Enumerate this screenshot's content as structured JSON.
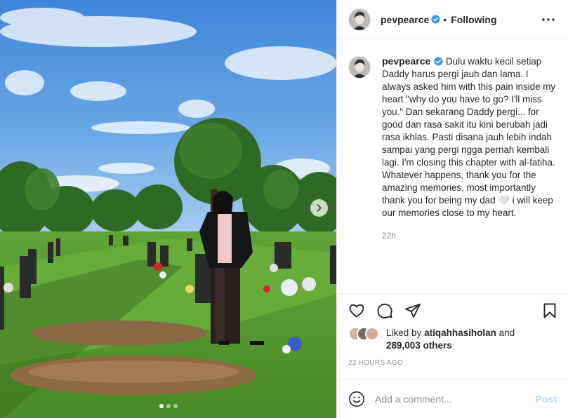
{
  "post": {
    "username": "pevpearce",
    "follow_state": "Following",
    "separator": "•",
    "caption": "Dulu waktu kecil setiap Daddy harus pergi jauh dan lama. I always asked him with this pain inside my heart \"why do you have to go? I'll miss you.\" Dan sekarang Daddy pergi... for good dan rasa sakit itu kini berubah jadi rasa ikhlas. Pasti disana jauh lebih indah sampai yang pergi ngga pernah kembali lagi. I'm closing this chapter with al-fatiha. Whatever happens, thank you for the amazing memories, most importantly thank you for being my dad 🤍 i will keep our memories close to my heart.",
    "caption_time": "22h",
    "liked_by_prefix": "Liked by",
    "liked_by_user": "atiqahhasiholan",
    "liked_by_and": "and",
    "liked_by_others": "289,003 others",
    "date": "22 HOURS AGO",
    "comment_placeholder": "Add a comment...",
    "post_button": "Post",
    "carousel": {
      "slide_count": 3,
      "active_slide": 1
    }
  },
  "icons": {
    "verified": "verified-badge-icon",
    "more": "more-options-icon",
    "like": "heart-icon",
    "comment": "comment-bubble-icon",
    "share": "paper-plane-icon",
    "save": "bookmark-icon",
    "emoji": "smiley-icon",
    "next": "chevron-right-icon"
  },
  "colors": {
    "verified": "#3897f0",
    "post_disabled": "#b2dffc",
    "secondary_text": "#8e8e8e"
  }
}
